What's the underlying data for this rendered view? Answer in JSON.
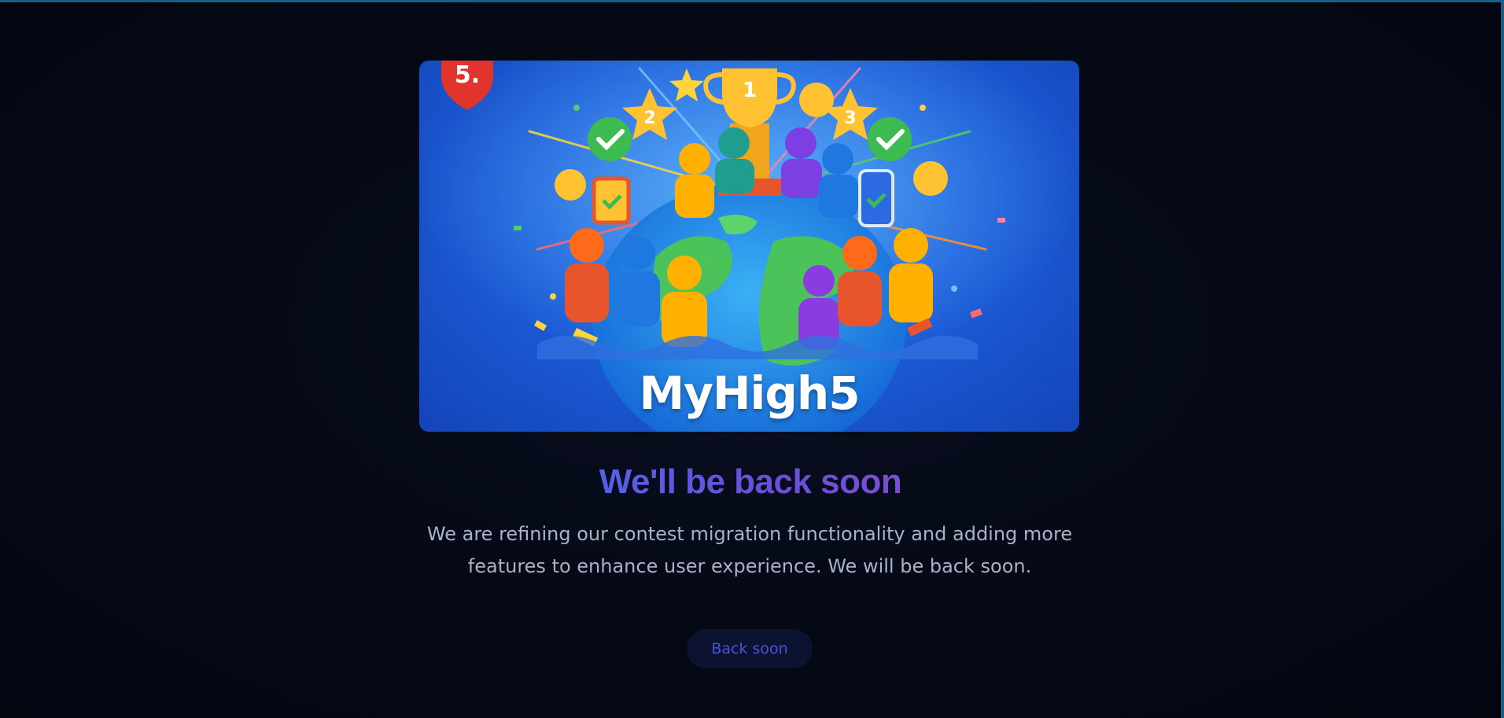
{
  "hero": {
    "brand": "MyHigh5",
    "badge_text": "5.",
    "trophy_number": "1",
    "left_star_number": "2",
    "right_star_number": "3"
  },
  "main": {
    "heading": "We'll be back soon",
    "message": "We are refining our contest migration functionality and adding more features to enhance user experience. We will be back soon."
  },
  "actions": {
    "back_button_label": "Back soon"
  },
  "colors": {
    "background": "#040814",
    "frame_border": "#1d5c86",
    "heading_accent": "#5f58e0",
    "body_text": "#aab2c2",
    "button_bg": "#0b1330",
    "button_text": "#4a52d8"
  }
}
